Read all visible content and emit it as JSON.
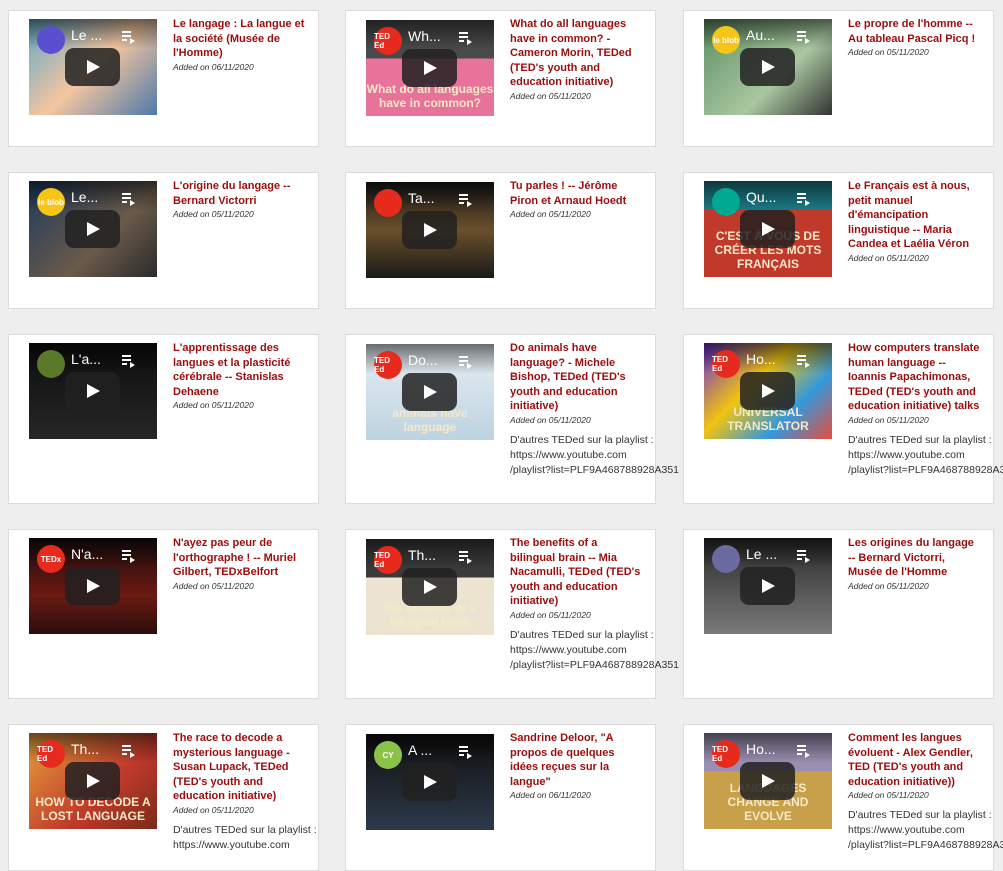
{
  "videos": [
    {
      "title": "Le langage : La langue et la société (Musée de l'Homme)",
      "date": "Added on 06/11/2020",
      "thumb_title": "Le ...",
      "channel": "",
      "desc": ""
    },
    {
      "title": "What do all languages have in common? - Cameron Morin, TEDed (TED's youth and education initiative)",
      "date": "Added on 05/11/2020",
      "thumb_title": "Wh...",
      "channel": "TED Ed",
      "watermark": "What do all languages have in common?",
      "desc": ""
    },
    {
      "title": "Le propre de l'homme -- Au tableau Pascal Picq !",
      "date": "Added on 05/11/2020",
      "thumb_title": "Au...",
      "channel": "le blob",
      "desc": ""
    },
    {
      "title": "L'origine du langage -- Bernard Victorri",
      "date": "Added on 05/11/2020",
      "thumb_title": "Le...",
      "channel": "le blob",
      "desc": ""
    },
    {
      "title": "Tu parles ! -- Jérôme Piron et Arnaud Hoedt",
      "date": "Added on 05/11/2020",
      "thumb_title": "Ta...",
      "channel": "",
      "desc": ""
    },
    {
      "title": "Le Français est à nous, petit manuel d'émancipation linguistique -- Maria Candea et Laélia Véron",
      "date": "Added on 05/11/2020",
      "thumb_title": "Qu...",
      "channel": "",
      "watermark": "C'EST À VOUS DE CRÉER LES MOTS FRANÇAIS",
      "desc": ""
    },
    {
      "title": "L'apprentissage des langues et la plasticité cérébrale -- Stanislas Dehaene",
      "date": "Added on 05/11/2020",
      "thumb_title": "L'a...",
      "channel": "",
      "desc": ""
    },
    {
      "title": "Do animals have language? - Michele Bishop, TEDed (TED's youth and education initiative)",
      "date": "Added on 05/11/2020",
      "thumb_title": "Do...",
      "channel": "TED Ed",
      "watermark": "animals have language",
      "desc": "D'autres TEDed sur la playlist :\nhttps://www.youtube.com\n/playlist?list=PLF9A468788928A351"
    },
    {
      "title": "How computers translate human language -- Ioannis Papachimonas, TEDed (TED's youth and education initiative) talks",
      "date": "Added on 05/11/2020",
      "thumb_title": "Ho...",
      "channel": "TED Ed",
      "watermark": "UNIVERSAL TRANSLATOR",
      "desc": "D'autres TEDed sur la playlist :\nhttps://www.youtube.com\n/playlist?list=PLF9A468788928A3"
    },
    {
      "title": "N'ayez pas peur de l'orthographe ! -- Muriel Gilbert, TEDxBelfort",
      "date": "Added on 05/11/2020",
      "thumb_title": "N'a...",
      "channel": "TEDx",
      "desc": ""
    },
    {
      "title": "The benefits of a bilingual brain -- Mia Nacamulli, TEDed (TED's youth and education initiative)",
      "date": "Added on 05/11/2020",
      "thumb_title": "Th...",
      "channel": "TED Ed",
      "watermark": "the benefits of a bilingual brain",
      "desc": "D'autres TEDed sur la playlist :\nhttps://www.youtube.com\n/playlist?list=PLF9A468788928A351"
    },
    {
      "title": "Les origines du langage -- Bernard Victorri, Musée de l'Homme",
      "date": "Added on 05/11/2020",
      "thumb_title": "Le ...",
      "channel": "",
      "desc": ""
    },
    {
      "title": "The race to decode a mysterious language - Susan Lupack, TEDed (TED's youth and education initiative)",
      "date": "Added on 05/11/2020",
      "thumb_title": "Th...",
      "channel": "TED Ed",
      "watermark": "HOW TO DECODE A LOST LANGUAGE",
      "desc": "D'autres TEDed sur la playlist :\nhttps://www.youtube.com"
    },
    {
      "title": "Sandrine Deloor, \"A propos de quelques idées reçues sur la langue\"",
      "date": "Added on 06/11/2020",
      "thumb_title": "A ...",
      "channel": "CY",
      "desc": ""
    },
    {
      "title": "Comment les langues évoluent - Alex Gendler, TED (TED's youth and education initiative))",
      "date": "Added on 05/11/2020",
      "thumb_title": "Ho...",
      "channel": "TED Ed",
      "watermark": "LANGUAGES CHANGE AND EVOLVE",
      "desc": "D'autres TEDed sur la playlist :\nhttps://www.youtube.com\n/playlist?list=PLF9A468788928A3"
    }
  ],
  "colors": {
    "title": "#9b0d0d",
    "card_bg": "#ffffff",
    "page_bg": "#eeeeee",
    "ted_red": "#e62b1e"
  }
}
